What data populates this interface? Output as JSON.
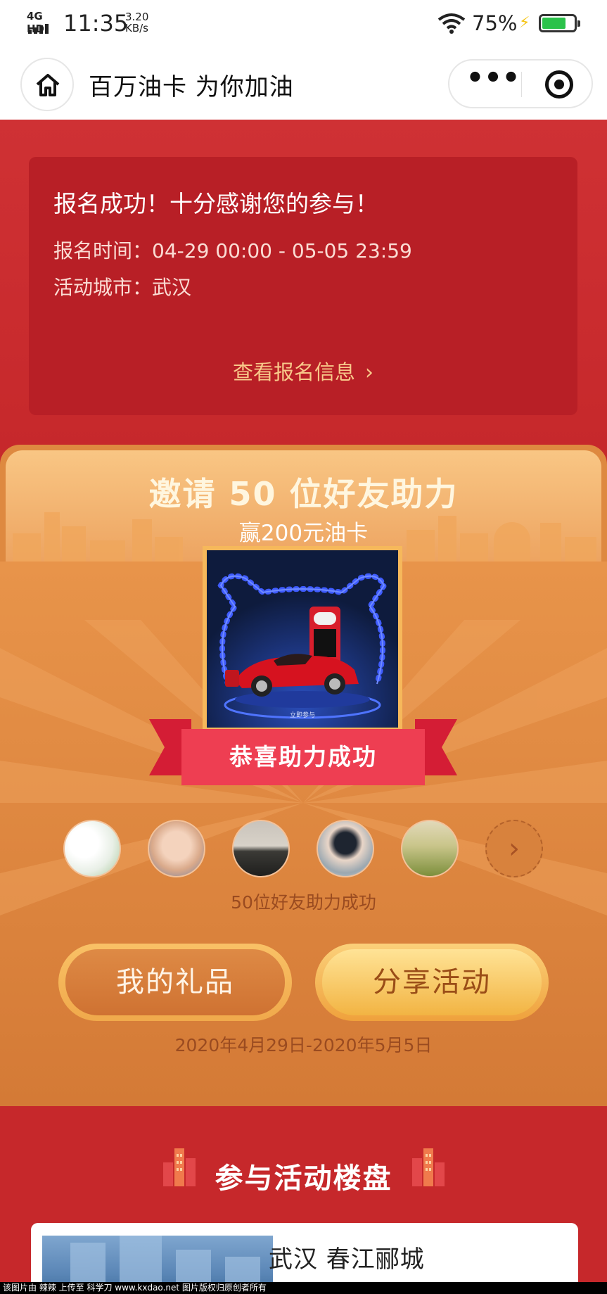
{
  "status_bar": {
    "network": "4G HD",
    "time": "11:35",
    "speed_value": "3.20",
    "speed_unit": "KB/s",
    "battery_pct": "75%",
    "battery_level": 0.75,
    "icons": [
      "signal-icon",
      "wifi-icon",
      "charging-bolt-icon",
      "battery-icon"
    ]
  },
  "nav": {
    "title": "百万油卡 为你加油",
    "more_label": "•••",
    "icons": [
      "home-icon",
      "more-icon",
      "close-mini-program-icon"
    ]
  },
  "registration": {
    "success_text": "报名成功！十分感谢您的参与！",
    "time_label": "报名时间：",
    "time_value": "04-29 00:00 - 05-05 23:59",
    "city_label": "活动城市：",
    "city_value": "武汉",
    "view_link": "查看报名信息",
    "accent_color": "#f8c98a"
  },
  "promo": {
    "headline": "邀请 50 位好友助力",
    "subheadline": "赢200元油卡",
    "prize_caption": "立即参与",
    "ribbon_text": "恭喜助力成功",
    "helped_text": "50位好友助力成功",
    "friends": [
      {
        "name": "friend-avatar-1",
        "style": "plant"
      },
      {
        "name": "friend-avatar-2",
        "style": "baby"
      },
      {
        "name": "friend-avatar-3",
        "style": "sky"
      },
      {
        "name": "friend-avatar-4",
        "style": "person"
      },
      {
        "name": "friend-avatar-5",
        "style": "field"
      }
    ],
    "more_arrow": "›",
    "gift_button": "我的礼品",
    "share_button": "分享活动",
    "date_range": "2020年4月29日-2020年5月5日"
  },
  "participating": {
    "section_title": "参与活动楼盘",
    "estate_name": "武汉 春江郦城"
  },
  "watermark": "该图片由 辣辣 上传至 科学刀 www.kxdao.net 图片版权归原创者所有"
}
